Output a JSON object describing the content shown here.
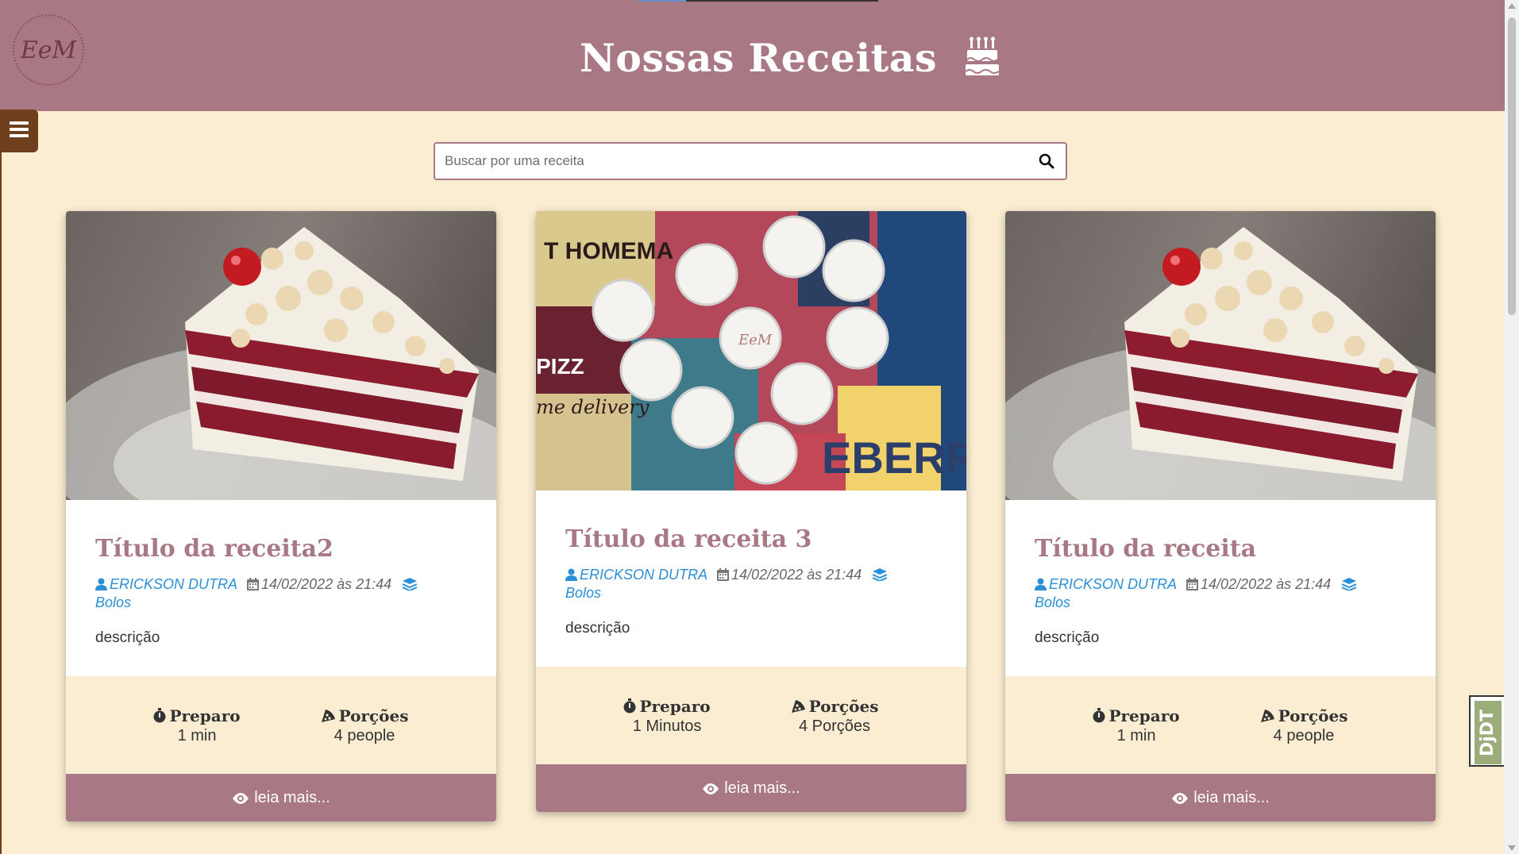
{
  "header": {
    "logo_text": "EeM",
    "title": "Nossas Receitas",
    "title_icon": "birthday-cake-icon"
  },
  "sidebar_toggle": {
    "icon": "hamburger-menu-icon"
  },
  "search": {
    "placeholder": "Buscar por uma receita",
    "value": "",
    "icon": "search-icon"
  },
  "recipes": [
    {
      "image": "red-velvet-cake-slice-photo",
      "title": "Título da receita2",
      "author": "ERICKSON DUTRA",
      "date": "14/02/2022 às 21:44",
      "category": "Bolos",
      "description": "descrição",
      "prep_label": "Preparo",
      "prep_value": "1 min",
      "servings_label": "Porções",
      "servings_value": "4 people",
      "read_more": "leia mais..."
    },
    {
      "image": "white-sweets-tray-photo",
      "title": "Título da receita 3",
      "author": "ERICKSON DUTRA",
      "date": "14/02/2022 às 21:44",
      "category": "Bolos",
      "description": "descrição",
      "prep_label": "Preparo",
      "prep_value": "1 Minutos",
      "servings_label": "Porções",
      "servings_value": "4 Porções",
      "read_more": "leia mais..."
    },
    {
      "image": "red-velvet-cake-slice-photo",
      "title": "Título da receita",
      "author": "ERICKSON DUTRA",
      "date": "14/02/2022 às 21:44",
      "category": "Bolos",
      "description": "descrição",
      "prep_label": "Preparo",
      "prep_value": "1 min",
      "servings_label": "Porções",
      "servings_value": "4 people",
      "read_more": "leia mais..."
    }
  ],
  "debug_toolbar": {
    "label": "DjDT"
  },
  "colors": {
    "header_bg": "#a97885",
    "page_bg": "#faedd2",
    "accent_link": "#2a8fd6",
    "menu_button": "#6e3f1d",
    "toolbar_green": "#9aad7b"
  }
}
